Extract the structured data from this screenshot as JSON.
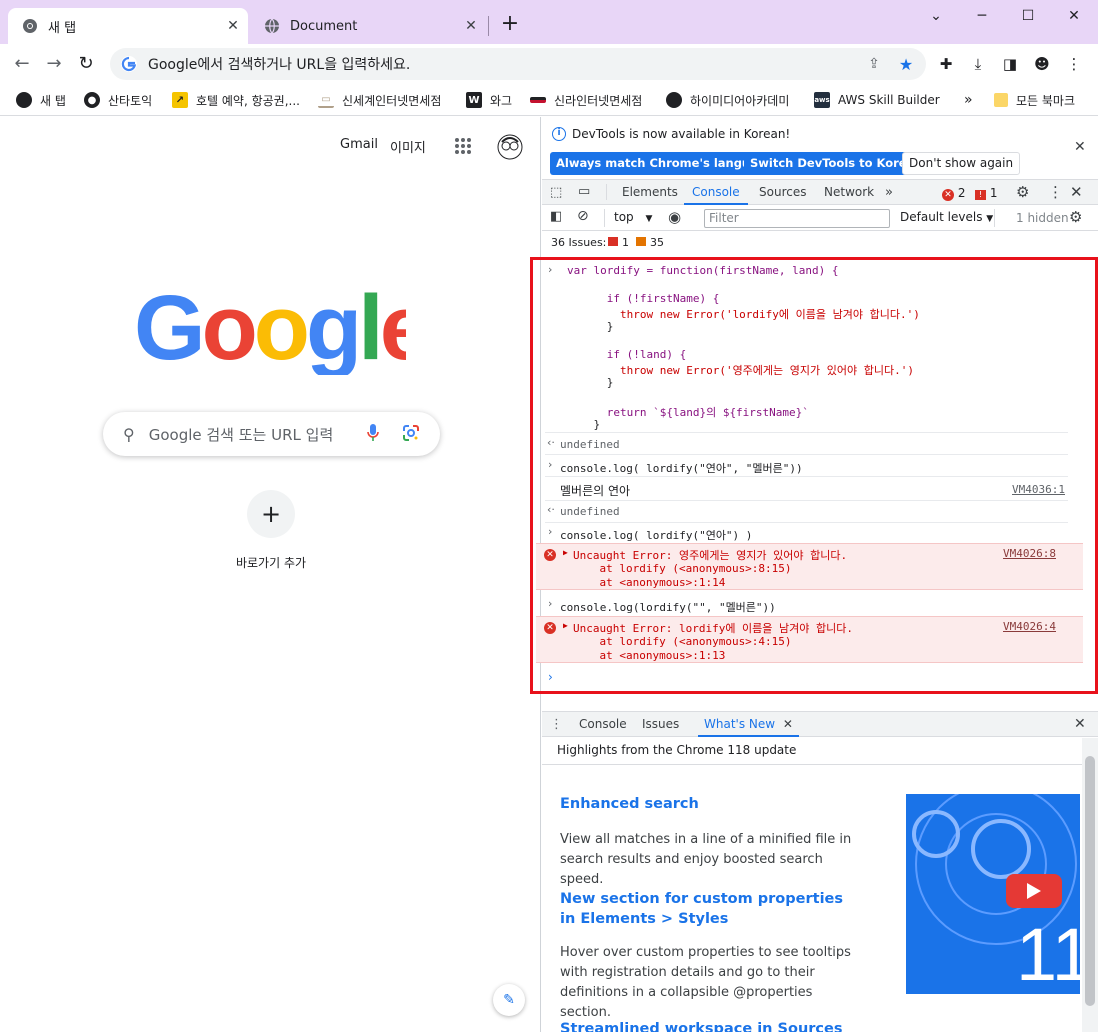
{
  "tabs": [
    {
      "title": "새 탭",
      "active": true
    },
    {
      "title": "Document",
      "active": false
    }
  ],
  "omnibox": {
    "text": "Google에서 검색하거나 URL을 입력하세요."
  },
  "bookmarks": [
    {
      "label": "새 탭",
      "icon": "globe-icon",
      "color": "#202124"
    },
    {
      "label": "산타토익",
      "icon": "santa-icon",
      "color": "#202124"
    },
    {
      "label": "호텔 예약, 항공권,...",
      "icon": "arrow-icon",
      "color": "#f5c400"
    },
    {
      "label": "신세계인터넷면세점",
      "icon": "ssg-icon",
      "color": "#b0a08a"
    },
    {
      "label": "와그",
      "icon": "w-icon",
      "color": "#202124"
    },
    {
      "label": "신라인터넷면세점",
      "icon": "shilla-icon",
      "color": "#c4122f"
    },
    {
      "label": "하이미디어아카데미",
      "icon": "globe-icon",
      "color": "#202124"
    },
    {
      "label": "AWS Skill Builder",
      "icon": "aws-icon",
      "color": "#232f3e"
    }
  ],
  "bookmarks_more": "»",
  "all_bookmarks": "모든 북마크",
  "newtab": {
    "gmail": "Gmail",
    "images": "이미지",
    "search_placeholder": "Google 검색 또는 URL 입력",
    "add_shortcut": "바로가기 추가"
  },
  "devtools": {
    "info_message": "DevTools is now available in Korean!",
    "btn_match": "Always match Chrome's language",
    "btn_switch": "Switch DevTools to Korean",
    "btn_dont": "Don't show again",
    "tabs": [
      "Elements",
      "Console",
      "Sources",
      "Network"
    ],
    "error_count": "2",
    "warning_count": "1",
    "context": "top",
    "filter_placeholder": "Filter",
    "levels": "Default levels",
    "hidden": "1 hidden",
    "issues_label": "36 Issues:",
    "issues_errors": "1",
    "issues_warnings": "35"
  },
  "console": {
    "lines": [
      "var lordify = function(firstName, land) {",
      "",
      "      if (!firstName) {",
      "        throw new Error('lordify에 이름을 남겨야 합니다.')",
      "      }",
      "",
      "      if (!land) {",
      "        throw new Error('영주에게는 영지가 있어야 합니다.')",
      "      }",
      "",
      "      return `${land}의 ${firstName}`",
      "    }"
    ],
    "undefined": "undefined",
    "cmd1": "console.log( lordify(\"연아\", \"멜버른\"))",
    "out1": "멜버른의 연아",
    "src1": "VM4036:1",
    "cmd2": "console.log( lordify(\"연아\") )",
    "err2": "Uncaught Error: 영주에게는 영지가 있어야 합니다.",
    "err2_l2": "    at lordify (<anonymous>:8:15)",
    "err2_l3": "    at <anonymous>:1:14",
    "src2": "VM4026:8",
    "cmd3": "console.log(lordify(\"\", \"멜버른\"))",
    "err3": "Uncaught Error: lordify에 이름을 남겨야 합니다.",
    "err3_l2": "    at lordify (<anonymous>:4:15)",
    "err3_l3": "    at <anonymous>:1:13",
    "src3": "VM4026:4"
  },
  "drawer": {
    "tabs": [
      "Console",
      "Issues",
      "What's New"
    ],
    "highlights": "Highlights from the Chrome 118 update",
    "items": [
      {
        "title": "Enhanced search",
        "body": "View all matches in a line of a minified file in search results and enjoy boosted search speed."
      },
      {
        "title": "New section for custom properties in Elements > Styles",
        "body": "Hover over custom properties to see tooltips with registration details and go to their definitions in a collapsible @properties section."
      },
      {
        "title": "Streamlined workspace in Sources",
        "body": ""
      }
    ],
    "image_number": "11"
  }
}
